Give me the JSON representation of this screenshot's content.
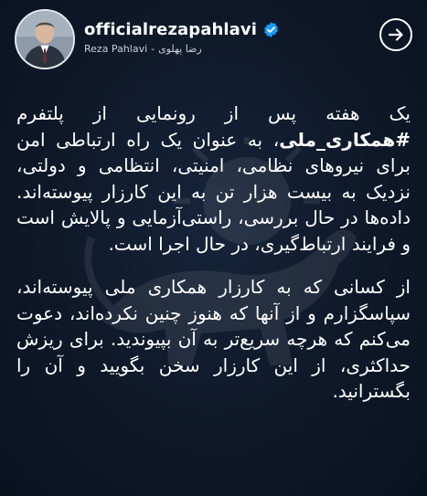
{
  "header": {
    "handle": "officialrezapahlavi",
    "display_name": "Reza Pahlavi",
    "separator": "-",
    "display_name_fa": "رضا پهلوی",
    "verified_icon": "verified-badge-icon",
    "arrow_icon": "arrow-right-icon"
  },
  "post": {
    "p1_lead": "یک هفته پس از رونمایی از پلتفرم ",
    "p1_hashtag": "#همکاری_ملی",
    "p1_rest": "، به عنوان یک راه ارتباطی امن برای نیروهای نظامی، امنیتی، انتظامی و دولتی، نزدیک به بیست هزار تن به این کارزار پیوسته‌اند. داده‌ها در حال بررسی، راستی‌آزمایی و پالایش است و فرایند ارتباط‌گیری، در حال اجرا است.",
    "p2": "از کسانی که به کارزار همکاری ملی پیوسته‌اند، سپاسگزارم و از آنها که هنوز چنین نکرده‌اند، دعوت می‌کنم که هرچه سریع‌تر به آن بپیوندید. برای ریزش حداکثری، از این کارزار سخن بگویید و آن را بگسترانید."
  },
  "colors": {
    "background": "#0c1525",
    "verified": "#1d9bf0",
    "text": "#ffffff"
  }
}
